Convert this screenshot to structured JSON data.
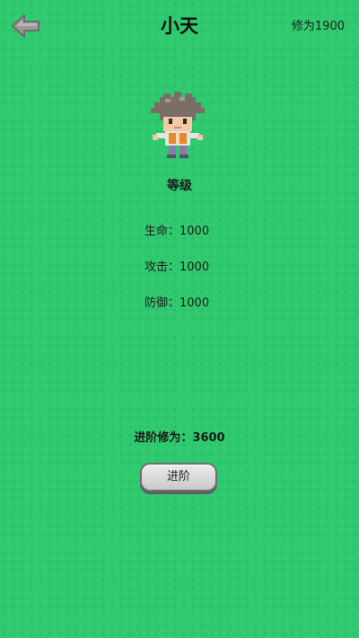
{
  "header": {
    "title": "小天",
    "cultivation_text": "修为1900"
  },
  "character": {
    "level_label": "等级"
  },
  "stats": {
    "hp": "生命：1000",
    "attack": "攻击：1000",
    "defense": "防御：1000"
  },
  "advance": {
    "cost_label": "进阶修为：",
    "cost_value": "3600",
    "button_label": "进阶"
  },
  "icons": {
    "back": "back-arrow-icon",
    "avatar": "pixel-character-avatar"
  },
  "colors": {
    "background": "#2fc96f",
    "button": "#d9d9d9"
  }
}
